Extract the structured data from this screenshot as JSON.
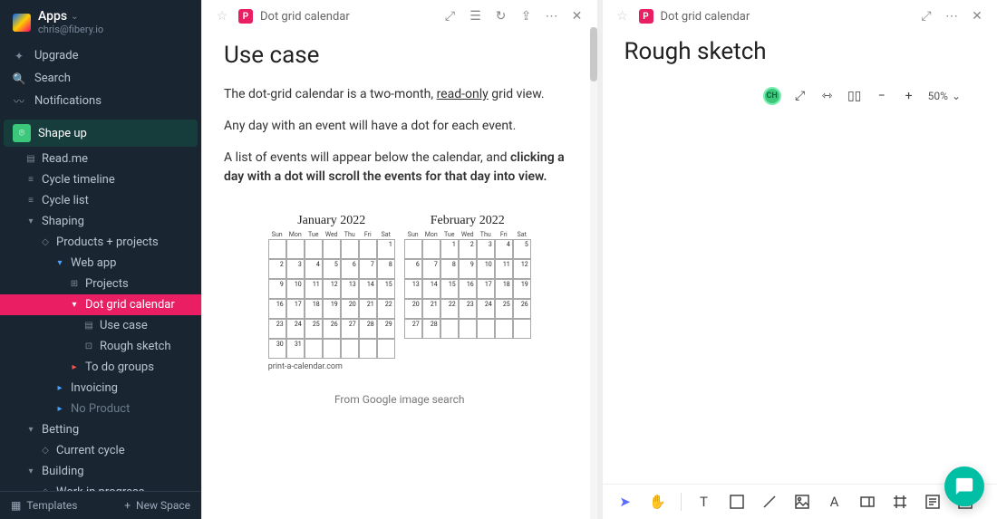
{
  "app": {
    "title": "Apps",
    "email": "chris@fibery.io"
  },
  "nav": {
    "upgrade": "Upgrade",
    "search": "Search",
    "notifications": "Notifications"
  },
  "space": {
    "name": "Shape up"
  },
  "tree": [
    {
      "label": "Read.me",
      "level": 1,
      "glyph": "doc"
    },
    {
      "label": "Cycle timeline",
      "level": 1,
      "glyph": "bars"
    },
    {
      "label": "Cycle list",
      "level": 1,
      "glyph": "bars"
    },
    {
      "label": "Shaping",
      "level": 1,
      "glyph": "caret"
    },
    {
      "label": "Products + projects",
      "level": 2,
      "glyph": "diamond"
    },
    {
      "label": "Web app",
      "level": 3,
      "glyph": "marker-blue"
    },
    {
      "label": "Projects",
      "level": 4,
      "glyph": "grid"
    },
    {
      "label": "Dot grid calendar",
      "level": 4,
      "glyph": "marker-white",
      "selected": true
    },
    {
      "label": "Use case",
      "level": 5,
      "glyph": "doc"
    },
    {
      "label": "Rough sketch",
      "level": 5,
      "glyph": "board"
    },
    {
      "label": "To do groups",
      "level": 4,
      "glyph": "tri-red"
    },
    {
      "label": "Invoicing",
      "level": 3,
      "glyph": "tri-blue"
    },
    {
      "label": "No Product",
      "level": 3,
      "glyph": "tri-blue",
      "muted": true
    },
    {
      "label": "Betting",
      "level": 1,
      "glyph": "caret"
    },
    {
      "label": "Current cycle",
      "level": 2,
      "glyph": "diamond"
    },
    {
      "label": "Building",
      "level": 1,
      "glyph": "caret"
    },
    {
      "label": "Work in progress",
      "level": 2,
      "glyph": "diamond"
    }
  ],
  "footer": {
    "templates": "Templates",
    "newspace": "New Space"
  },
  "panelLeft": {
    "crumb": "Dot grid calendar",
    "title": "Use case",
    "para1_pre": "The dot-grid calendar is a two-month, ",
    "para1_underlined": "read-only",
    "para1_post": " grid view.",
    "para2": "Any day with an event will have a dot for each event.",
    "para3_pre": "A list of events will appear below the calendar, and ",
    "para3_bold": "clicking a day with a dot will scroll the events for that day into view.",
    "cal1": {
      "title": "January 2022",
      "days": [
        "Sun",
        "Mon",
        "Tue",
        "Wed",
        "Thu",
        "Fri",
        "Sat"
      ]
    },
    "cal2": {
      "title": "February 2022",
      "days": [
        "Sun",
        "Mon",
        "Tue",
        "Wed",
        "Thu",
        "Fri",
        "Sat"
      ]
    },
    "footnote": "print-a-calendar.com",
    "caption": "From Google image search"
  },
  "panelRight": {
    "crumb": "Dot grid calendar",
    "title": "Rough sketch",
    "zoom": "50%"
  }
}
